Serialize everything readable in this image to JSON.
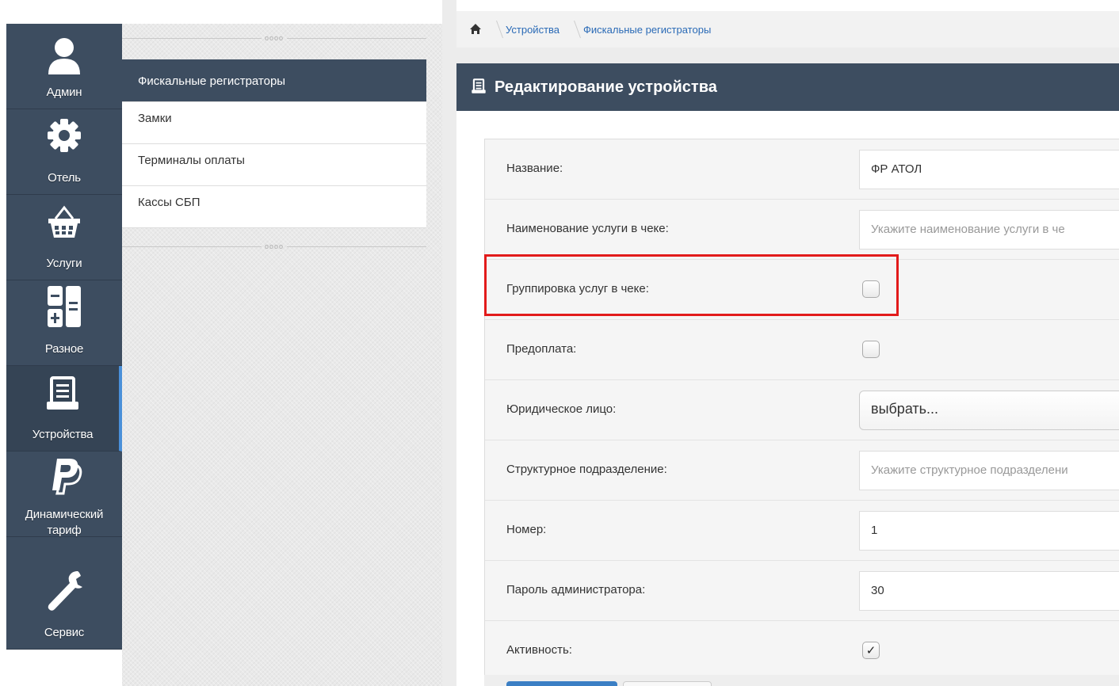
{
  "nav": {
    "items": [
      {
        "label": "Админ",
        "icon": "user-icon"
      },
      {
        "label": "Отель",
        "icon": "gear-icon"
      },
      {
        "label": "Услуги",
        "icon": "basket-icon"
      },
      {
        "label": "Разное",
        "icon": "calculator-icon"
      },
      {
        "label": "Устройства",
        "icon": "devices-icon",
        "active": true
      },
      {
        "label": "Динамический тариф",
        "label_line1": "Динамический",
        "label_line2": "тариф",
        "icon": "paypal-icon"
      },
      {
        "label": "Сервис",
        "icon": "wrench-icon"
      }
    ]
  },
  "submenu": {
    "items": [
      {
        "label": "Фискальные регистраторы",
        "active": true
      },
      {
        "label": "Замки"
      },
      {
        "label": "Терминалы оплаты"
      },
      {
        "label": "Кассы СБП"
      }
    ],
    "divider": "oooo"
  },
  "breadcrumb": {
    "home_icon": "home-icon",
    "items": [
      "Устройства",
      "Фискальные регистраторы"
    ]
  },
  "panel": {
    "icon": "devices-icon",
    "title": "Редактирование устройства"
  },
  "form": {
    "name_label": "Название:",
    "name_value": "ФР АТОЛ",
    "service_label": "Наименование услуги в чеке:",
    "service_placeholder": "Укажите наименование услуги в че",
    "grouping_label": "Группировка услуг в чеке:",
    "grouping_checked": false,
    "prepay_label": "Предоплата:",
    "prepay_checked": false,
    "legal_label": "Юридическое лицо:",
    "legal_value": "выбрать...",
    "division_label": "Структурное подразделение:",
    "division_placeholder": "Укажите структурное подразделени",
    "number_label": "Номер:",
    "number_value": "1",
    "password_label": "Пароль администратора:",
    "password_value": "30",
    "active_label": "Активность:",
    "active_checked": true,
    "check_mark": "✓"
  },
  "colors": {
    "nav_bg": "#3d4d60",
    "highlight": "#e21b1b",
    "link": "#2a6ab6"
  }
}
